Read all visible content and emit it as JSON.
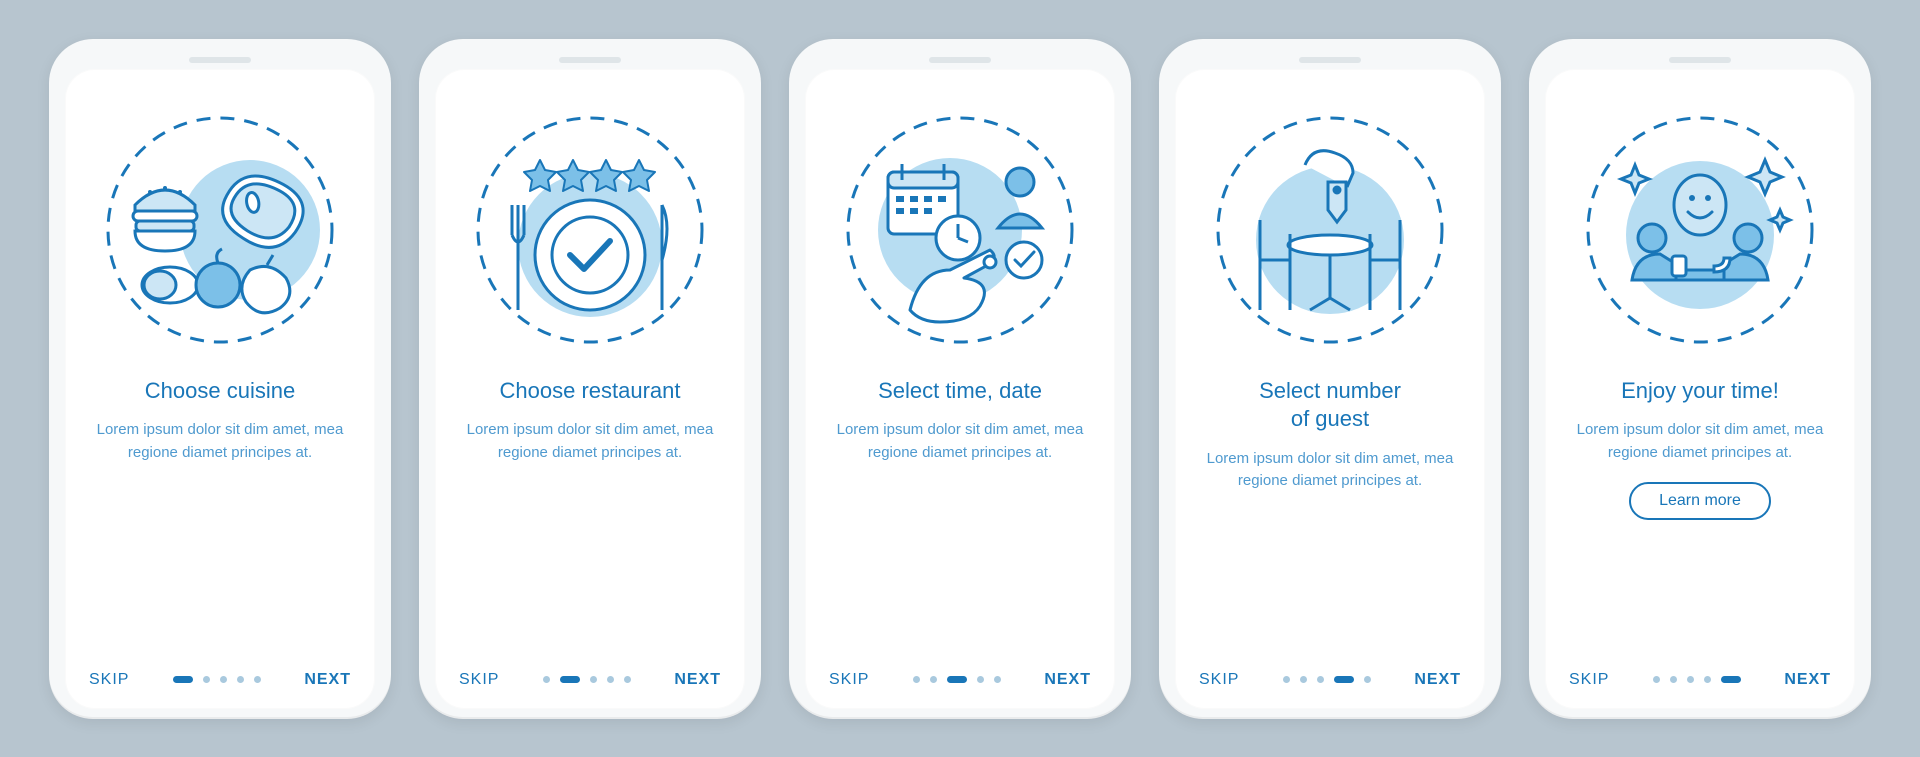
{
  "colors": {
    "primary": "#1976b8",
    "accent": "#7cc0e8",
    "bg": "#b7c5cf",
    "light": "#cce6f5"
  },
  "screens": [
    {
      "icon": "cuisine-icon",
      "title": "Choose cuisine",
      "body": "Lorem ipsum dolor sit dim amet, mea regione diamet principes at.",
      "skip": "SKIP",
      "next": "NEXT",
      "active_dot": 0,
      "learn_more": null
    },
    {
      "icon": "restaurant-rating-icon",
      "title": "Choose restaurant",
      "body": "Lorem ipsum dolor sit dim amet, mea regione diamet principes at.",
      "skip": "SKIP",
      "next": "NEXT",
      "active_dot": 1,
      "learn_more": null
    },
    {
      "icon": "calendar-time-icon",
      "title": "Select time, date",
      "body": "Lorem ipsum dolor sit dim amet, mea regione diamet principes at.",
      "skip": "SKIP",
      "next": "NEXT",
      "active_dot": 2,
      "learn_more": null
    },
    {
      "icon": "table-guests-icon",
      "title": "Select number\nof guest",
      "body": "Lorem ipsum dolor sit dim amet, mea regione diamet principes at.",
      "skip": "SKIP",
      "next": "NEXT",
      "active_dot": 3,
      "learn_more": null
    },
    {
      "icon": "enjoy-icon",
      "title": "Enjoy your time!",
      "body": "Lorem ipsum dolor sit dim amet, mea regione diamet principes at.",
      "skip": "SKIP",
      "next": "NEXT",
      "active_dot": 4,
      "learn_more": "Learn more"
    }
  ],
  "dot_count": 5
}
